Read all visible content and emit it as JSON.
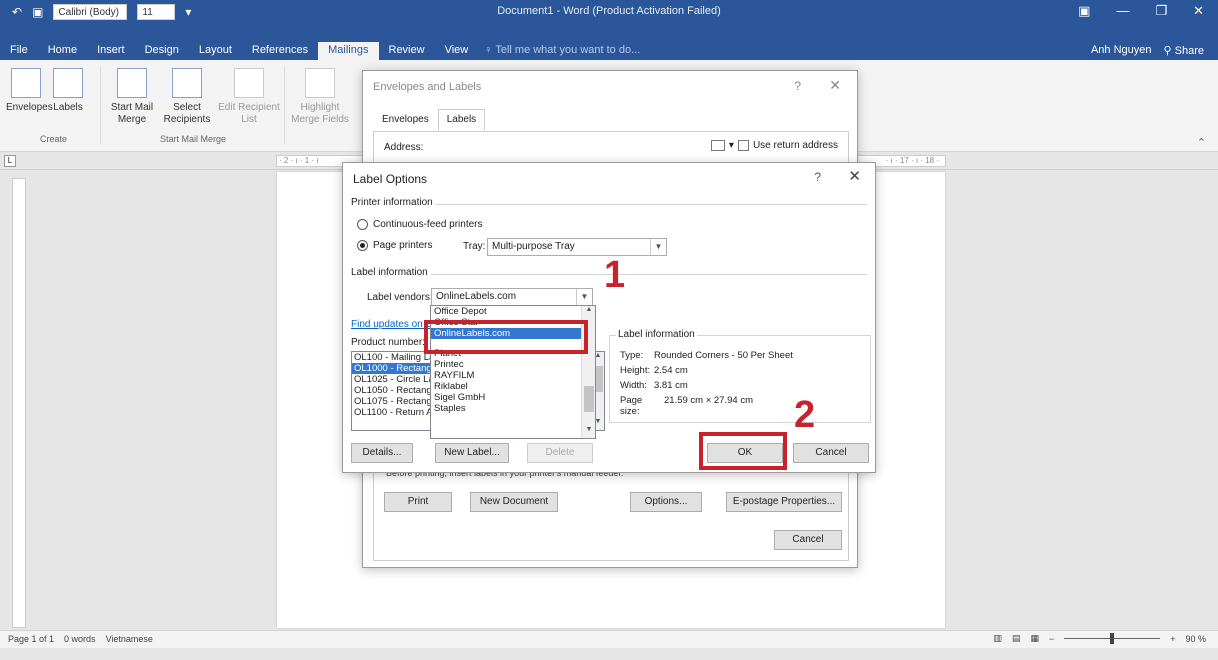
{
  "titlebar": {
    "font_name": "Calibri (Body)",
    "font_size": "11",
    "title": "Document1 - Word (Product Activation Failed)",
    "undo_icon": "undo-icon",
    "save_icon": "save-icon"
  },
  "menu": {
    "tabs": [
      "File",
      "Home",
      "Insert",
      "Design",
      "Layout",
      "References",
      "Mailings",
      "Review",
      "View"
    ],
    "active_tab": "Mailings",
    "tellme": "Tell me what you want to do...",
    "user": "Anh Nguyen",
    "share": "Share"
  },
  "ribbon": {
    "envelopes": "Envelopes",
    "labels": "Labels",
    "start_mail_merge": "Start Mail Merge",
    "select_recipients": "Select Recipients",
    "edit_recipient_list": "Edit Recipient List",
    "highlight_merge_fields": "Highlight Merge Fields",
    "group_create": "Create",
    "group_start_mail_merge": "Start Mail Merge"
  },
  "ruler": {
    "left_marks": "· 2 · ı · 1 · ı",
    "right_marks": "· ı · 17 · ı · 18 ·"
  },
  "env_dialog": {
    "title": "Envelopes and Labels",
    "help": "?",
    "close": "✕",
    "tab_envelopes": "Envelopes",
    "tab_labels": "Labels",
    "address_label": "Address:",
    "use_return_address": "Use return address",
    "feeder_text": "Before printing, insert labels in your printer's manual feeder.",
    "print": "Print",
    "new_document": "New Document",
    "options": "Options...",
    "epostage": "E-postage Properties...",
    "cancel": "Cancel"
  },
  "label_options": {
    "title": "Label Options",
    "help": "?",
    "close": "✕",
    "printer_info_heading": "Printer information",
    "continuous_feed": "Continuous-feed printers",
    "page_printers": "Page printers",
    "tray_label": "Tray:",
    "tray_value": "Multi-purpose Tray",
    "label_info_heading": "Label information",
    "label_vendors_label": "Label vendors:",
    "label_vendors_value": "OnlineLabels.com",
    "find_updates": "Find updates on Office.com",
    "product_number_label": "Product number:",
    "product_list": [
      "OL100 - Mailing Labels",
      "OL1000 - Rectangle Labels",
      "OL1025 - Circle Labels",
      "OL1050 - Rectangle Labels",
      "OL1075 - Rectangle Labels",
      "OL1100 - Return Address Labels"
    ],
    "product_selected_index": 1,
    "vendor_list": [
      "Office Depot",
      "Office Star",
      "OnlineLabels.com",
      "Planet",
      "Printec",
      "RAYFILM",
      "Riklabel",
      "Sigel GmbH",
      "Staples"
    ],
    "vendor_selected_index": 2,
    "info_legend": "Label information",
    "info": {
      "type_label": "Type:",
      "type_value": "Rounded Corners - 50 Per Sheet",
      "height_label": "Height:",
      "height_value": "2.54 cm",
      "width_label": "Width:",
      "width_value": "3.81 cm",
      "pagesize_label": "Page size:",
      "pagesize_value": "21.59 cm × 27.94 cm"
    },
    "details": "Details...",
    "new_label": "New Label...",
    "delete": "Delete",
    "ok": "OK",
    "cancel": "Cancel"
  },
  "annotations": {
    "step1": "1",
    "step2": "2",
    "color": "#c8232c"
  },
  "status": {
    "page": "Page 1 of 1",
    "words": "0 words",
    "language": "Vietnamese",
    "zoom": "90 %",
    "zoom_level": 0.9
  },
  "colors": {
    "title_blue": "#2b579a",
    "selection_blue": "#3377d0",
    "link_blue": "#0563c1"
  }
}
